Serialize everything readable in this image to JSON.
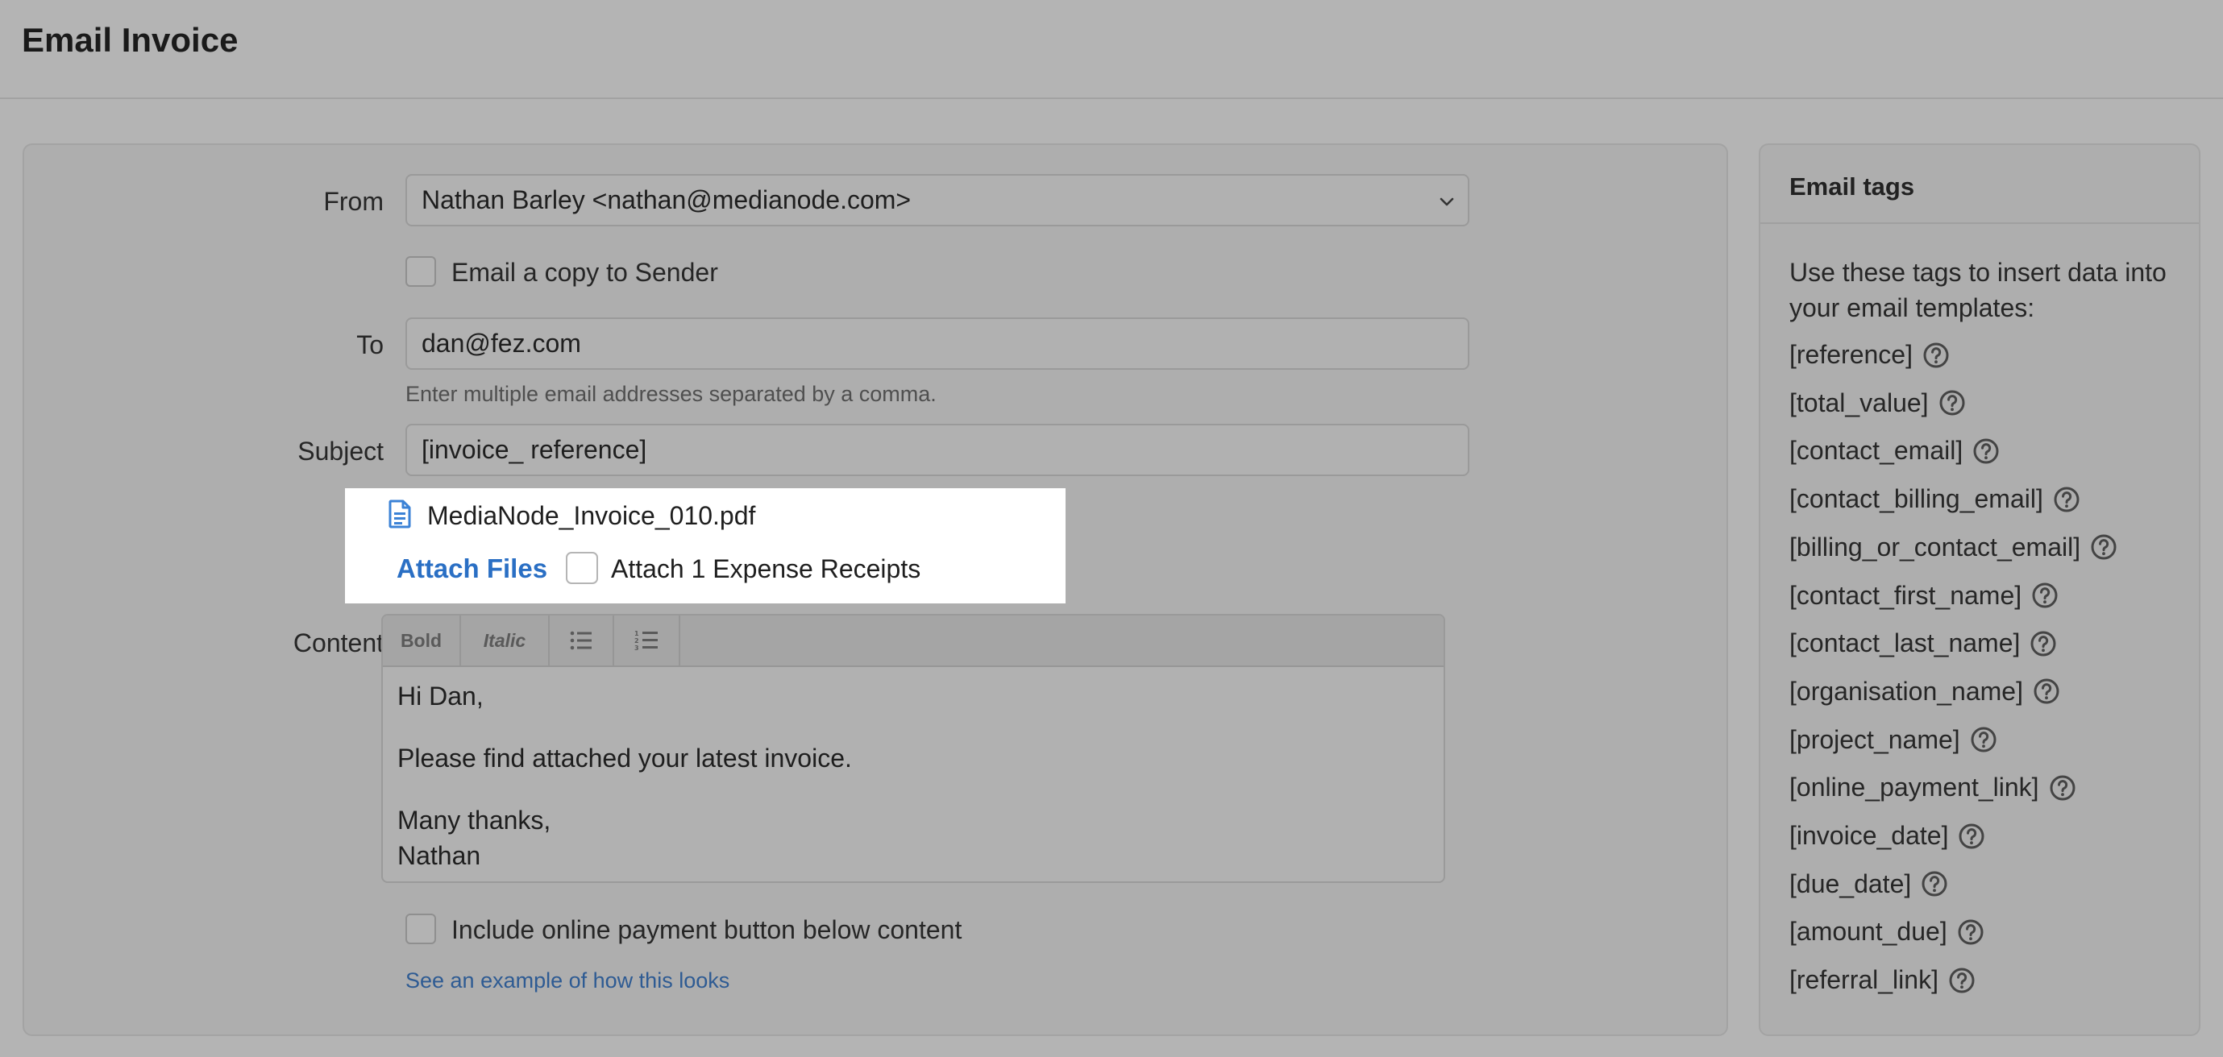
{
  "header": {
    "title": "Email Invoice"
  },
  "form": {
    "from_label": "From",
    "from_value": "Nathan Barley <nathan@medianode.com>",
    "copy_sender_label": "Email a copy to Sender",
    "to_label": "To",
    "to_value": "dan@fez.com",
    "to_hint": "Enter multiple email addresses separated by a comma.",
    "subject_label": "Subject",
    "subject_value": "[invoice_ reference]",
    "attachment_filename": "MediaNode_Invoice_010.pdf",
    "attach_files_label": "Attach Files",
    "attach_receipts_label": "Attach 1 Expense Receipts",
    "content_label": "Content",
    "toolbar": {
      "bold": "Bold",
      "italic": "Italic"
    },
    "content_lines": {
      "greeting": "Hi Dan,",
      "body": "Please find attached your latest invoice.",
      "signoff": "Many thanks,",
      "name": "Nathan"
    },
    "payment_button_label": "Include online payment button below content",
    "example_link": "See an example of how this looks"
  },
  "sidebar": {
    "title": "Email tags",
    "description": "Use these tags to insert data into your email templates:",
    "tags": [
      "[reference]",
      "[total_value]",
      "[contact_email]",
      "[contact_billing_email]",
      "[billing_or_contact_email]",
      "[contact_first_name]",
      "[contact_last_name]",
      "[organisation_name]",
      "[project_name]",
      "[online_payment_link]",
      "[invoice_date]",
      "[due_date]",
      "[amount_due]",
      "[referral_link]"
    ]
  },
  "colors": {
    "link": "#2a6fc4",
    "file_icon": "#3b82d6",
    "overlay": "#b4b4b4"
  }
}
